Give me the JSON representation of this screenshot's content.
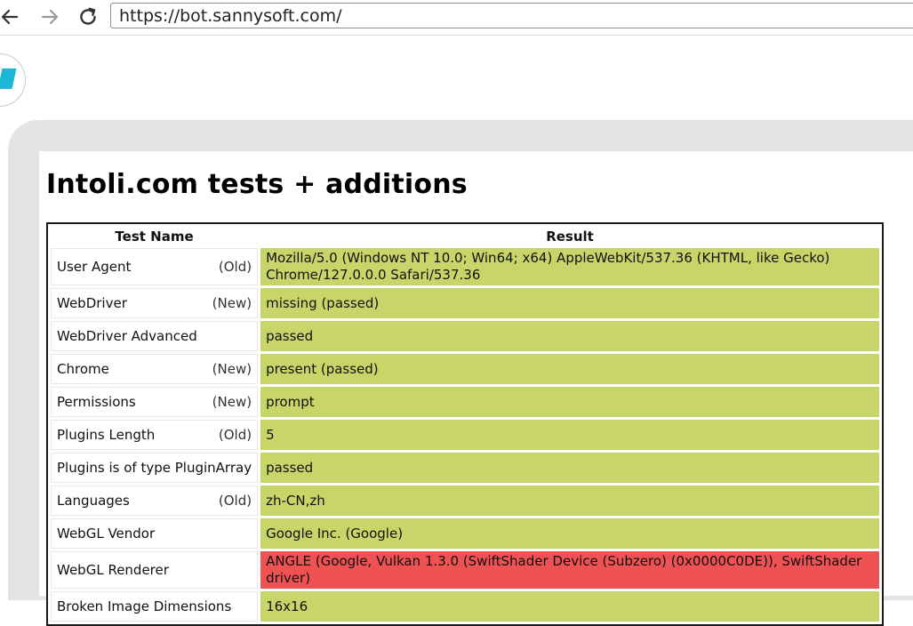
{
  "browser": {
    "url": "https://bot.sannysoft.com/",
    "back_icon": "arrow-left-icon",
    "forward_icon": "arrow-right-icon",
    "reload_icon": "reload-icon"
  },
  "page": {
    "heading": "Intoli.com tests + additions",
    "table": {
      "headers": [
        "Test Name",
        "Result"
      ],
      "rows": [
        {
          "name": "User Agent",
          "tag": "(Old)",
          "result": "Mozilla/5.0 (Windows NT 10.0; Win64; x64) AppleWebKit/537.36 (KHTML, like Gecko) Chrome/127.0.0.0 Safari/537.36",
          "status": "passed"
        },
        {
          "name": "WebDriver",
          "tag": "(New)",
          "result": "missing (passed)",
          "status": "passed"
        },
        {
          "name": "WebDriver Advanced",
          "tag": "",
          "result": "passed",
          "status": "passed"
        },
        {
          "name": "Chrome",
          "tag": "(New)",
          "result": "present (passed)",
          "status": "passed"
        },
        {
          "name": "Permissions",
          "tag": "(New)",
          "result": "prompt",
          "status": "passed"
        },
        {
          "name": "Plugins Length",
          "tag": "(Old)",
          "result": "5",
          "status": "passed"
        },
        {
          "name": "Plugins is of type PluginArray",
          "tag": "",
          "result": "passed",
          "status": "passed"
        },
        {
          "name": "Languages",
          "tag": "(Old)",
          "result": "zh-CN,zh",
          "status": "passed"
        },
        {
          "name": "WebGL Vendor",
          "tag": "",
          "result": "Google Inc. (Google)",
          "status": "passed"
        },
        {
          "name": "WebGL Renderer",
          "tag": "",
          "result": "ANGLE (Google, Vulkan 1.3.0 (SwiftShader Device (Subzero) (0x0000C0DE)), SwiftShader driver)",
          "status": "failed"
        },
        {
          "name": "Broken Image Dimensions",
          "tag": "",
          "result": "16x16",
          "status": "passed"
        }
      ]
    }
  },
  "colors": {
    "passed": "#c8d568",
    "failed": "#ee5252"
  }
}
